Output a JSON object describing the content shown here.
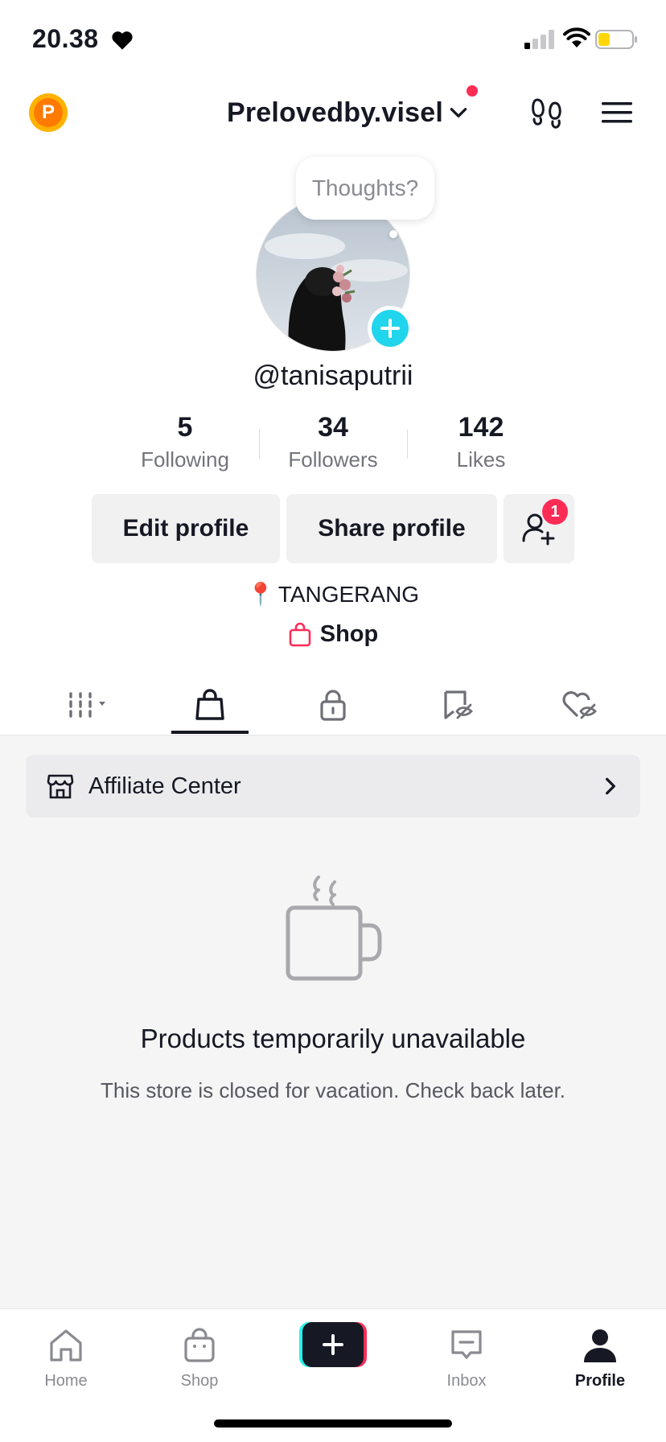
{
  "status_bar": {
    "time": "20.38",
    "icons": [
      "heart-icon",
      "signal-icon",
      "wifi-icon",
      "battery-icon"
    ]
  },
  "header": {
    "coin_letter": "P",
    "account_name": "Prelovedby.visel",
    "has_notification_dot": true,
    "icons": [
      "coin-icon",
      "chevron-down-icon",
      "footprint-icon",
      "menu-icon"
    ]
  },
  "profile": {
    "thought_bubble": "Thoughts?",
    "username": "@tanisaputrii",
    "stats": [
      {
        "value": "5",
        "label": "Following"
      },
      {
        "value": "34",
        "label": "Followers"
      },
      {
        "value": "142",
        "label": "Likes"
      }
    ],
    "buttons": {
      "edit": "Edit profile",
      "share": "Share profile",
      "friends_badge": "1"
    },
    "location_pin": "📍",
    "location": "TANGERANG",
    "shop_label": "Shop"
  },
  "tabs": [
    {
      "name": "videos",
      "icon": "grid-icon",
      "active": false
    },
    {
      "name": "shop",
      "icon": "shopping-bag-icon",
      "active": true
    },
    {
      "name": "private",
      "icon": "lock-icon",
      "active": false
    },
    {
      "name": "favorites",
      "icon": "bookmark-hidden-icon",
      "active": false
    },
    {
      "name": "liked",
      "icon": "heart-hidden-icon",
      "active": false
    }
  ],
  "content": {
    "affiliate_label": "Affiliate Center",
    "empty_title": "Products temporarily unavailable",
    "empty_description": "This store is closed for vacation. Check back later."
  },
  "bottom_nav": [
    {
      "label": "Home",
      "icon": "home-icon",
      "active": false
    },
    {
      "label": "Shop",
      "icon": "shop-bag-icon",
      "active": false
    },
    {
      "label": "",
      "icon": "plus-icon",
      "active": false
    },
    {
      "label": "Inbox",
      "icon": "inbox-icon",
      "active": false
    },
    {
      "label": "Profile",
      "icon": "profile-icon",
      "active": true
    }
  ],
  "colors": {
    "accent_red": "#fe2c55",
    "accent_cyan": "#20d5ec",
    "coin_orange": "#ff7a00",
    "battery_yellow": "#ffd60a"
  }
}
